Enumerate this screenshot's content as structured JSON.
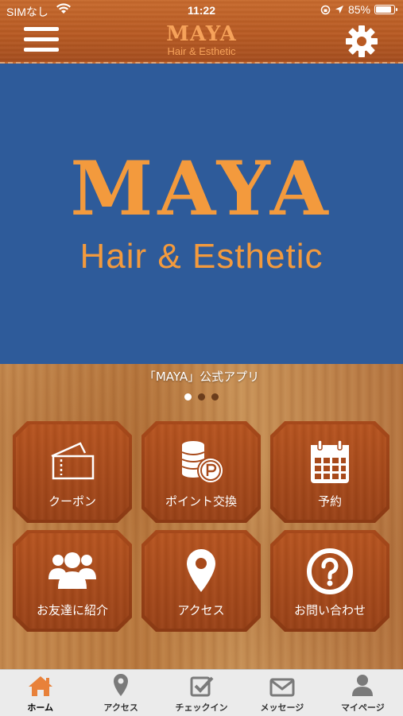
{
  "status": {
    "carrier": "SIMなし",
    "time": "11:22",
    "battery": "85%"
  },
  "header": {
    "brand_title": "MAYA",
    "brand_subtitle": "Hair & Esthetic"
  },
  "banner": {
    "title": "MAYA",
    "subtitle": "Hair & Esthetic"
  },
  "carousel": {
    "caption": "「MAYA」公式アプリ",
    "pages": 3,
    "active": 1
  },
  "tiles": [
    {
      "label": "クーポン",
      "icon": "ticket-icon"
    },
    {
      "label": "ポイント交換",
      "icon": "coins-icon"
    },
    {
      "label": "予約",
      "icon": "calendar-icon"
    },
    {
      "label": "お友達に紹介",
      "icon": "people-icon"
    },
    {
      "label": "アクセス",
      "icon": "map-pin-icon"
    },
    {
      "label": "お問い合わせ",
      "icon": "question-icon"
    }
  ],
  "tabs": [
    {
      "label": "ホーム",
      "icon": "home-icon",
      "active": true
    },
    {
      "label": "アクセス",
      "icon": "map-pin-icon"
    },
    {
      "label": "チェックイン",
      "icon": "checkin-icon"
    },
    {
      "label": "メッセージ",
      "icon": "envelope-icon"
    },
    {
      "label": "マイページ",
      "icon": "person-icon"
    }
  ],
  "colors": {
    "accent": "#f39a3d",
    "banner_bg": "#2e5b9a",
    "home_tab": "#e8813a"
  }
}
